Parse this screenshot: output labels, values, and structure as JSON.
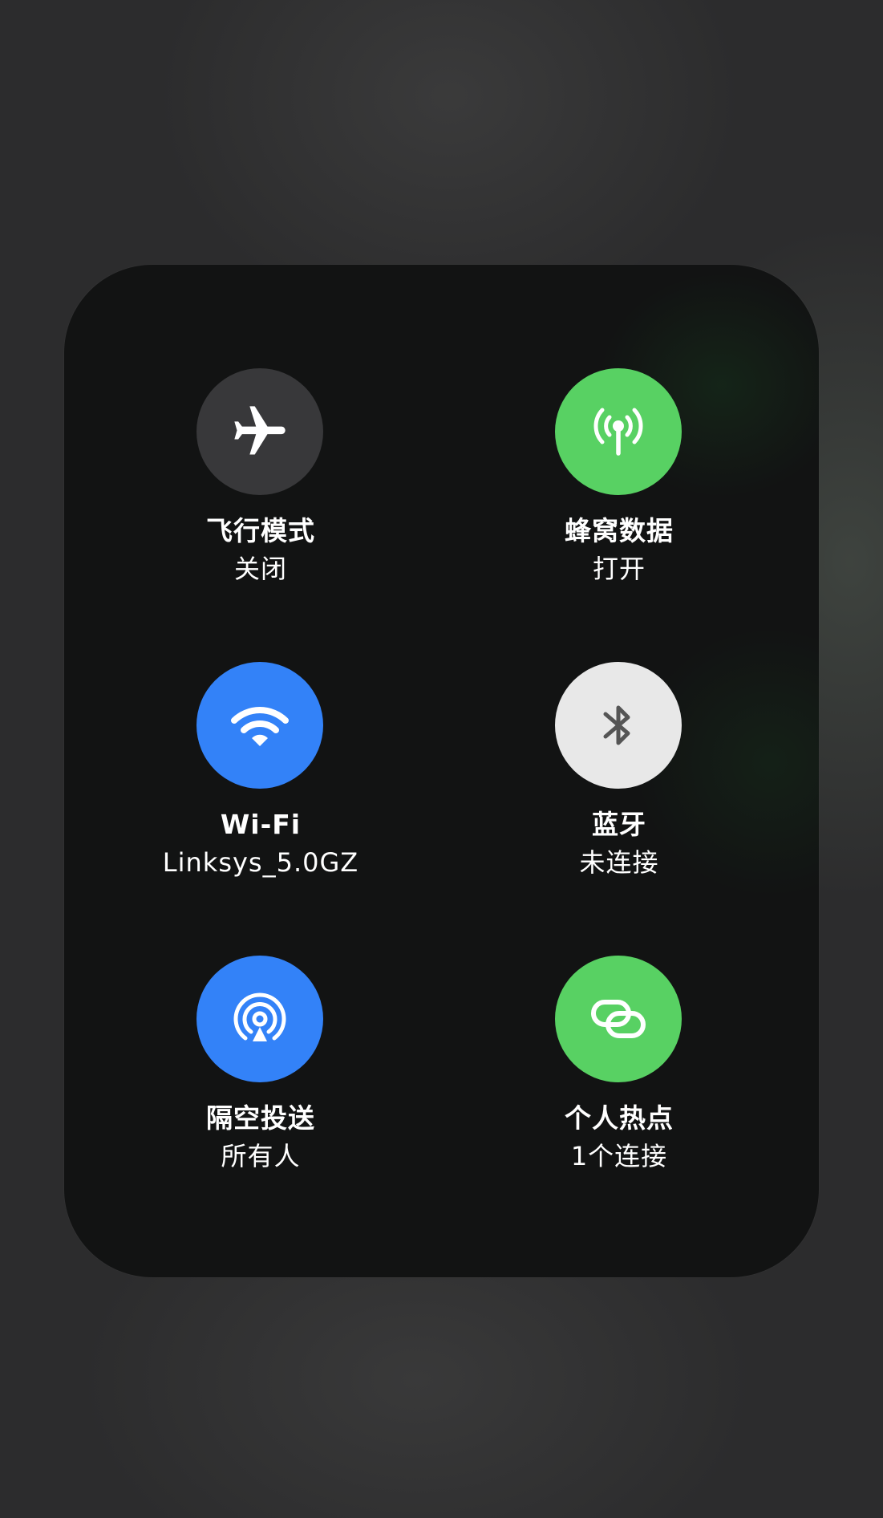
{
  "colors": {
    "off_gray": "#38383a",
    "green": "#58d163",
    "blue": "#3382f8",
    "bt_off": "#e8e8e8"
  },
  "tiles": [
    {
      "title": "飞行模式",
      "status": "关闭",
      "icon": "airplane-icon",
      "state": "off"
    },
    {
      "title": "蜂窝数据",
      "status": "打开",
      "icon": "cellular-antenna-icon",
      "state": "on"
    },
    {
      "title": "Wi-Fi",
      "status": "Linksys_5.0GZ",
      "icon": "wifi-icon",
      "state": "on"
    },
    {
      "title": "蓝牙",
      "status": "未连接",
      "icon": "bluetooth-icon",
      "state": "on-not-connected"
    },
    {
      "title": "隔空投送",
      "status": "所有人",
      "icon": "airdrop-icon",
      "state": "on"
    },
    {
      "title": "个人热点",
      "status": "1个连接",
      "icon": "personal-hotspot-icon",
      "state": "on"
    }
  ]
}
